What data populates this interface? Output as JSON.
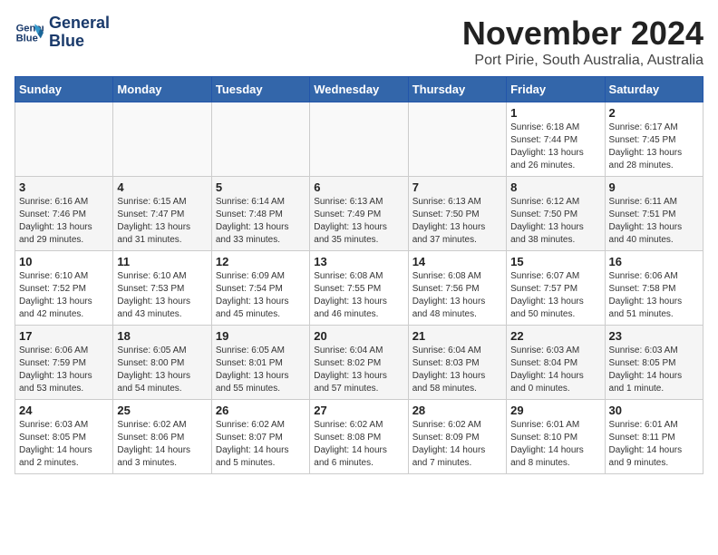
{
  "logo": {
    "line1": "General",
    "line2": "Blue"
  },
  "title": "November 2024",
  "location": "Port Pirie, South Australia, Australia",
  "days_of_week": [
    "Sunday",
    "Monday",
    "Tuesday",
    "Wednesday",
    "Thursday",
    "Friday",
    "Saturday"
  ],
  "weeks": [
    [
      {
        "day": "",
        "info": ""
      },
      {
        "day": "",
        "info": ""
      },
      {
        "day": "",
        "info": ""
      },
      {
        "day": "",
        "info": ""
      },
      {
        "day": "",
        "info": ""
      },
      {
        "day": "1",
        "info": "Sunrise: 6:18 AM\nSunset: 7:44 PM\nDaylight: 13 hours\nand 26 minutes."
      },
      {
        "day": "2",
        "info": "Sunrise: 6:17 AM\nSunset: 7:45 PM\nDaylight: 13 hours\nand 28 minutes."
      }
    ],
    [
      {
        "day": "3",
        "info": "Sunrise: 6:16 AM\nSunset: 7:46 PM\nDaylight: 13 hours\nand 29 minutes."
      },
      {
        "day": "4",
        "info": "Sunrise: 6:15 AM\nSunset: 7:47 PM\nDaylight: 13 hours\nand 31 minutes."
      },
      {
        "day": "5",
        "info": "Sunrise: 6:14 AM\nSunset: 7:48 PM\nDaylight: 13 hours\nand 33 minutes."
      },
      {
        "day": "6",
        "info": "Sunrise: 6:13 AM\nSunset: 7:49 PM\nDaylight: 13 hours\nand 35 minutes."
      },
      {
        "day": "7",
        "info": "Sunrise: 6:13 AM\nSunset: 7:50 PM\nDaylight: 13 hours\nand 37 minutes."
      },
      {
        "day": "8",
        "info": "Sunrise: 6:12 AM\nSunset: 7:50 PM\nDaylight: 13 hours\nand 38 minutes."
      },
      {
        "day": "9",
        "info": "Sunrise: 6:11 AM\nSunset: 7:51 PM\nDaylight: 13 hours\nand 40 minutes."
      }
    ],
    [
      {
        "day": "10",
        "info": "Sunrise: 6:10 AM\nSunset: 7:52 PM\nDaylight: 13 hours\nand 42 minutes."
      },
      {
        "day": "11",
        "info": "Sunrise: 6:10 AM\nSunset: 7:53 PM\nDaylight: 13 hours\nand 43 minutes."
      },
      {
        "day": "12",
        "info": "Sunrise: 6:09 AM\nSunset: 7:54 PM\nDaylight: 13 hours\nand 45 minutes."
      },
      {
        "day": "13",
        "info": "Sunrise: 6:08 AM\nSunset: 7:55 PM\nDaylight: 13 hours\nand 46 minutes."
      },
      {
        "day": "14",
        "info": "Sunrise: 6:08 AM\nSunset: 7:56 PM\nDaylight: 13 hours\nand 48 minutes."
      },
      {
        "day": "15",
        "info": "Sunrise: 6:07 AM\nSunset: 7:57 PM\nDaylight: 13 hours\nand 50 minutes."
      },
      {
        "day": "16",
        "info": "Sunrise: 6:06 AM\nSunset: 7:58 PM\nDaylight: 13 hours\nand 51 minutes."
      }
    ],
    [
      {
        "day": "17",
        "info": "Sunrise: 6:06 AM\nSunset: 7:59 PM\nDaylight: 13 hours\nand 53 minutes."
      },
      {
        "day": "18",
        "info": "Sunrise: 6:05 AM\nSunset: 8:00 PM\nDaylight: 13 hours\nand 54 minutes."
      },
      {
        "day": "19",
        "info": "Sunrise: 6:05 AM\nSunset: 8:01 PM\nDaylight: 13 hours\nand 55 minutes."
      },
      {
        "day": "20",
        "info": "Sunrise: 6:04 AM\nSunset: 8:02 PM\nDaylight: 13 hours\nand 57 minutes."
      },
      {
        "day": "21",
        "info": "Sunrise: 6:04 AM\nSunset: 8:03 PM\nDaylight: 13 hours\nand 58 minutes."
      },
      {
        "day": "22",
        "info": "Sunrise: 6:03 AM\nSunset: 8:04 PM\nDaylight: 14 hours\nand 0 minutes."
      },
      {
        "day": "23",
        "info": "Sunrise: 6:03 AM\nSunset: 8:05 PM\nDaylight: 14 hours\nand 1 minute."
      }
    ],
    [
      {
        "day": "24",
        "info": "Sunrise: 6:03 AM\nSunset: 8:05 PM\nDaylight: 14 hours\nand 2 minutes."
      },
      {
        "day": "25",
        "info": "Sunrise: 6:02 AM\nSunset: 8:06 PM\nDaylight: 14 hours\nand 3 minutes."
      },
      {
        "day": "26",
        "info": "Sunrise: 6:02 AM\nSunset: 8:07 PM\nDaylight: 14 hours\nand 5 minutes."
      },
      {
        "day": "27",
        "info": "Sunrise: 6:02 AM\nSunset: 8:08 PM\nDaylight: 14 hours\nand 6 minutes."
      },
      {
        "day": "28",
        "info": "Sunrise: 6:02 AM\nSunset: 8:09 PM\nDaylight: 14 hours\nand 7 minutes."
      },
      {
        "day": "29",
        "info": "Sunrise: 6:01 AM\nSunset: 8:10 PM\nDaylight: 14 hours\nand 8 minutes."
      },
      {
        "day": "30",
        "info": "Sunrise: 6:01 AM\nSunset: 8:11 PM\nDaylight: 14 hours\nand 9 minutes."
      }
    ]
  ]
}
